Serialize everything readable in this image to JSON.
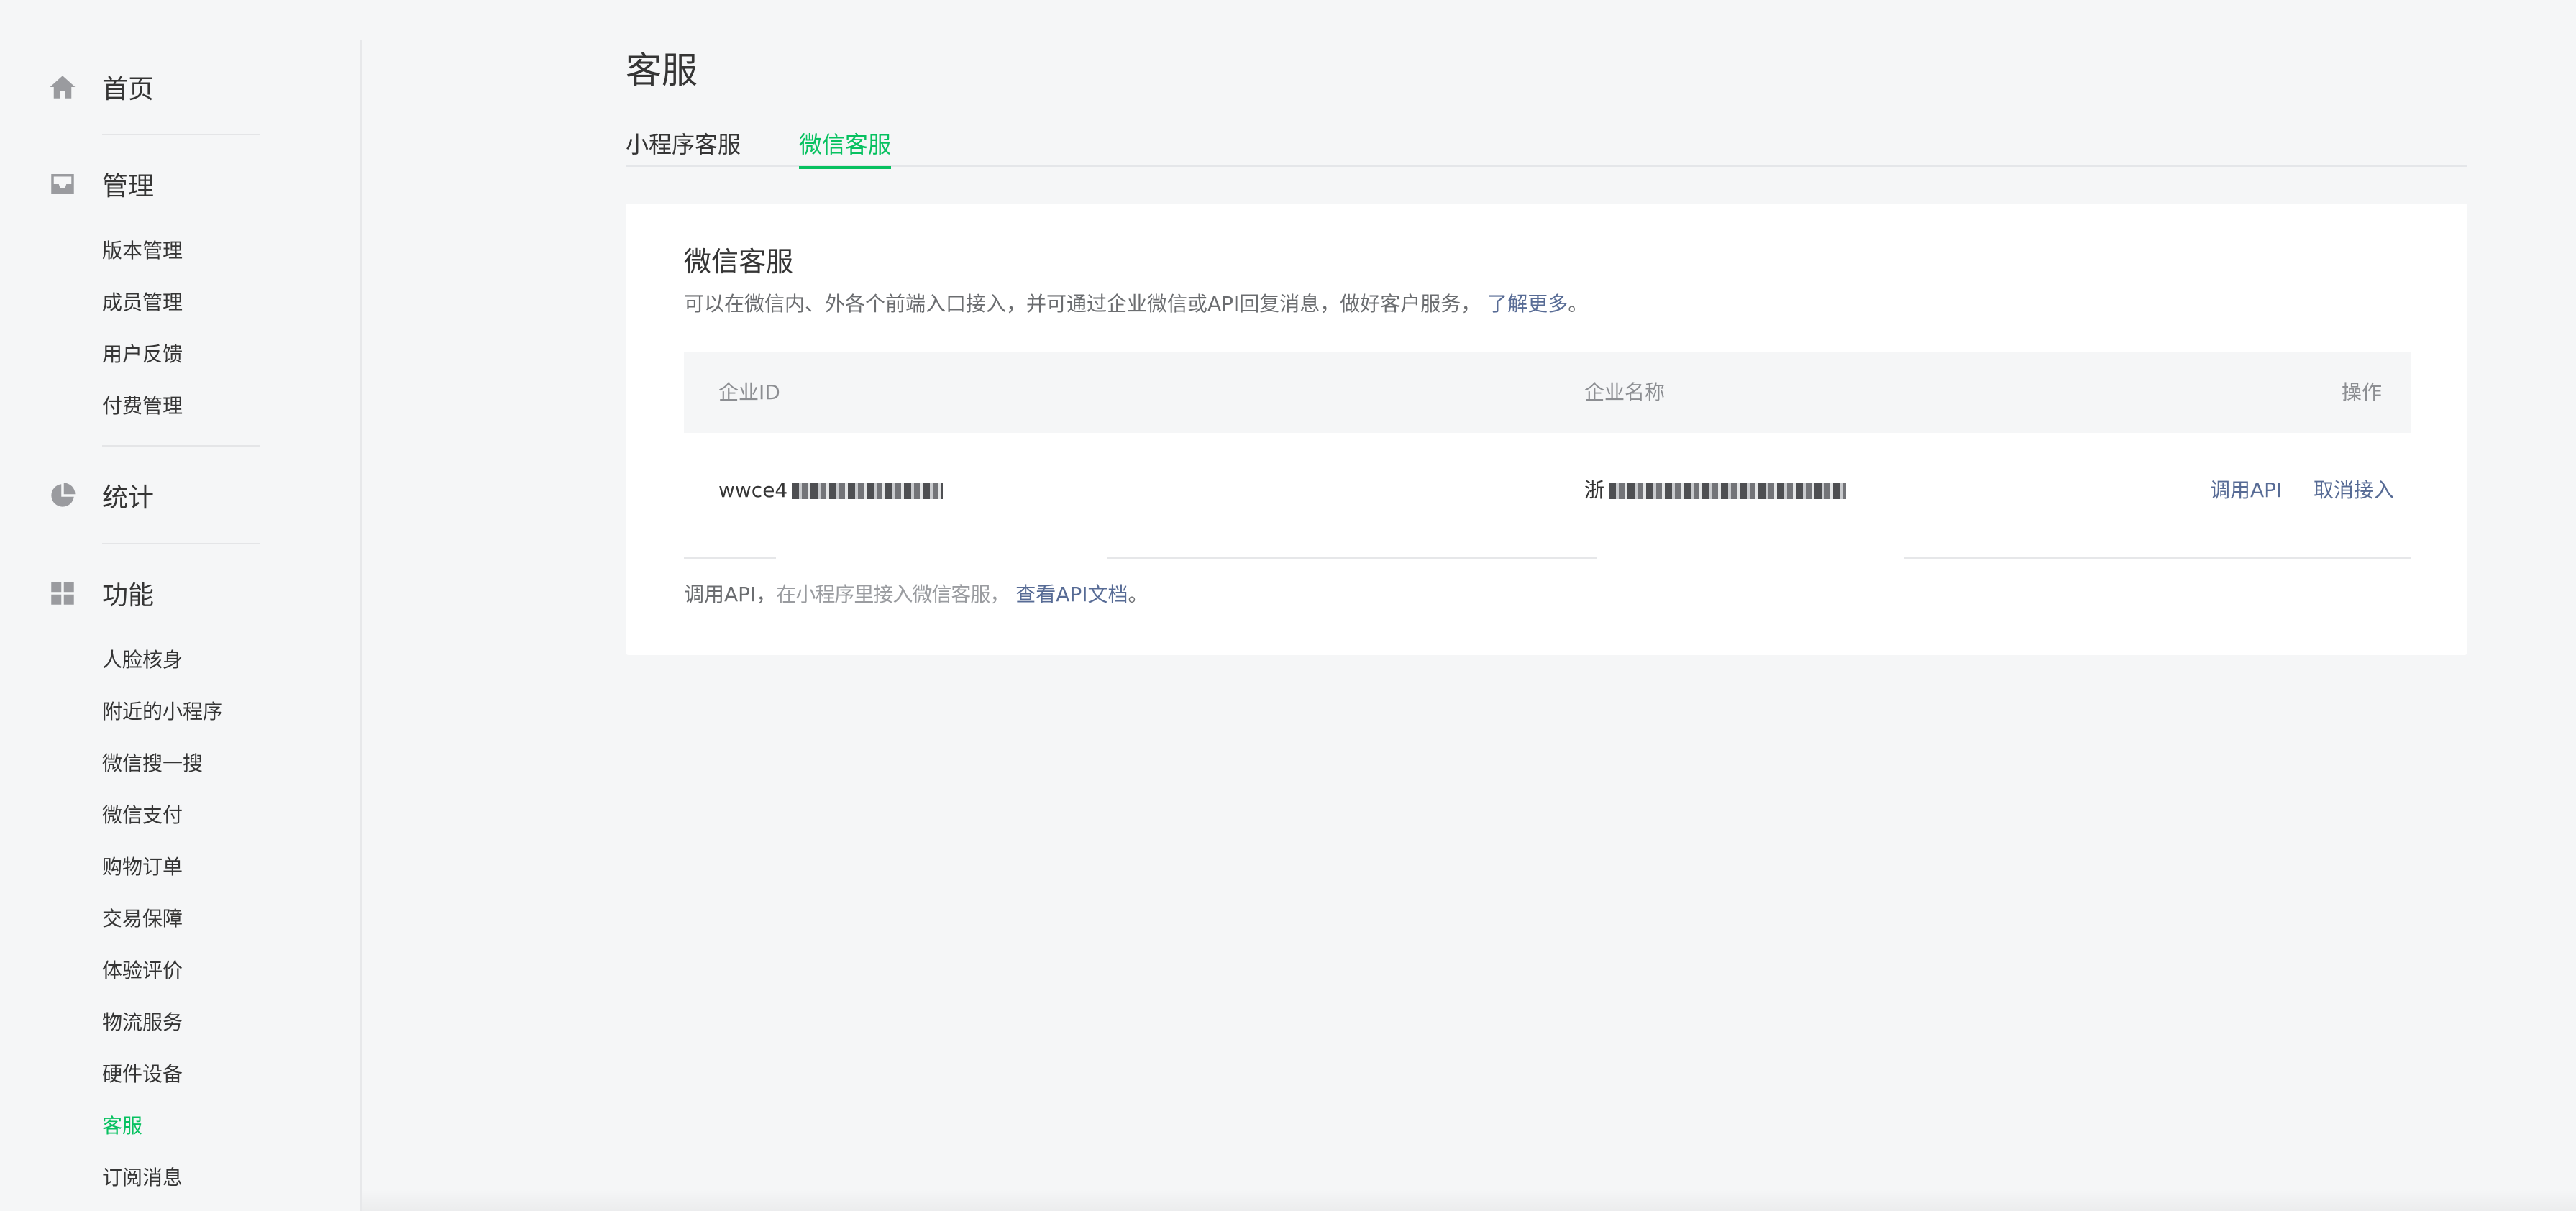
{
  "sidebar": {
    "home": {
      "label": "首页",
      "icon": "home-icon"
    },
    "manage": {
      "label": "管理",
      "icon": "inbox-icon",
      "items": [
        "版本管理",
        "成员管理",
        "用户反馈",
        "付费管理"
      ]
    },
    "stats": {
      "label": "统计",
      "icon": "pie-chart-icon"
    },
    "features": {
      "label": "功能",
      "icon": "grid-icon",
      "items": [
        "人脸核身",
        "附近的小程序",
        "微信搜一搜",
        "微信支付",
        "购物订单",
        "交易保障",
        "体验评价",
        "物流服务",
        "硬件设备",
        "客服",
        "订阅消息"
      ],
      "active_index": 9
    }
  },
  "page": {
    "title": "客服",
    "tabs": [
      {
        "label": "小程序客服",
        "active": false
      },
      {
        "label": "微信客服",
        "active": true
      }
    ]
  },
  "card": {
    "title": "微信客服",
    "desc": "可以在微信内、外各个前端入口接入，并可通过企业微信或API回复消息，做好客户服务，",
    "desc_link": "了解更多",
    "desc_end": "。",
    "table": {
      "headers": {
        "id": "企业ID",
        "name": "企业名称",
        "op": "操作"
      },
      "row": {
        "id_prefix": "wwce4",
        "name_prefix": "浙",
        "op_api": "调用API",
        "op_cancel": "取消接入"
      }
    },
    "footer": {
      "prefix": "调用API，",
      "middle": "在小程序里接入微信客服，",
      "link": "查看API文档",
      "end": "。"
    }
  },
  "colors": {
    "accent": "#07c160",
    "link": "#576b95",
    "background": "#f5f6f7"
  }
}
